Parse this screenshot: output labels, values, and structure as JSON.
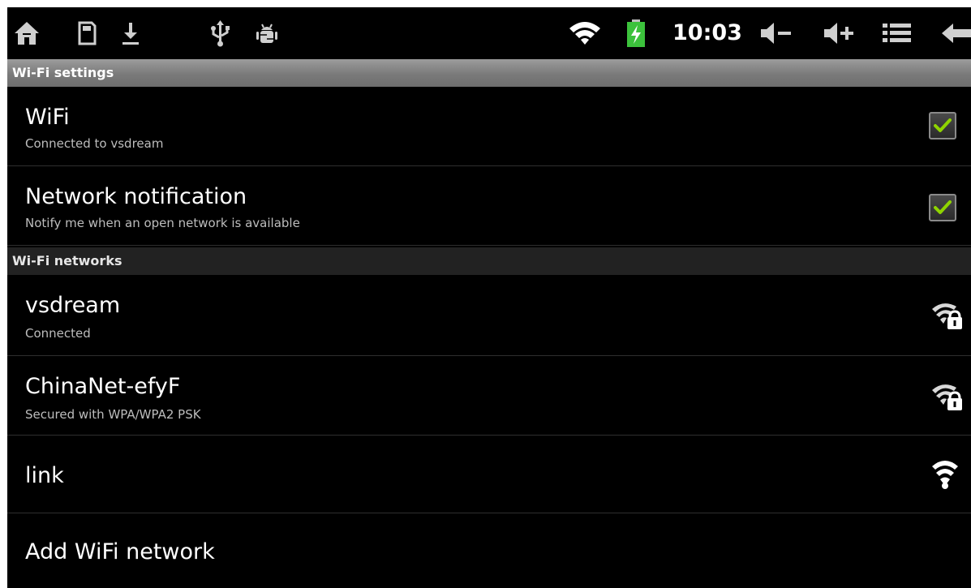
{
  "status_bar": {
    "time": "10:03",
    "icons": [
      "home-icon",
      "sd-card-icon",
      "download-icon",
      "usb-icon",
      "android-debug-icon",
      "wifi-signal-icon",
      "battery-charging-icon",
      "volume-down-icon",
      "volume-up-icon",
      "menu-icon",
      "back-icon"
    ]
  },
  "sections": {
    "settings_header": "Wi-Fi settings",
    "networks_header": "Wi-Fi networks"
  },
  "wifi_toggle": {
    "title": "WiFi",
    "summary": "Connected to vsdream",
    "checked": true
  },
  "network_notification": {
    "title": "Network notification",
    "summary": "Notify me when an open network is available",
    "checked": true
  },
  "networks": [
    {
      "ssid": "vsdream",
      "status": "Connected",
      "icon": "wifi-locked-icon"
    },
    {
      "ssid": "ChinaNet-efyF",
      "status": "Secured with WPA/WPA2 PSK",
      "icon": "wifi-locked-icon"
    },
    {
      "ssid": "link",
      "status": "",
      "icon": "wifi-open-icon"
    }
  ],
  "add_network": {
    "label": "Add WiFi network"
  },
  "colors": {
    "background": "#000000",
    "header_gradient_top": "#9c9c9c",
    "header_gradient_bottom": "#6e6e6e",
    "check_green": "#8fd400",
    "battery_green": "#3cc23c",
    "divider": "#2e2e2e"
  }
}
